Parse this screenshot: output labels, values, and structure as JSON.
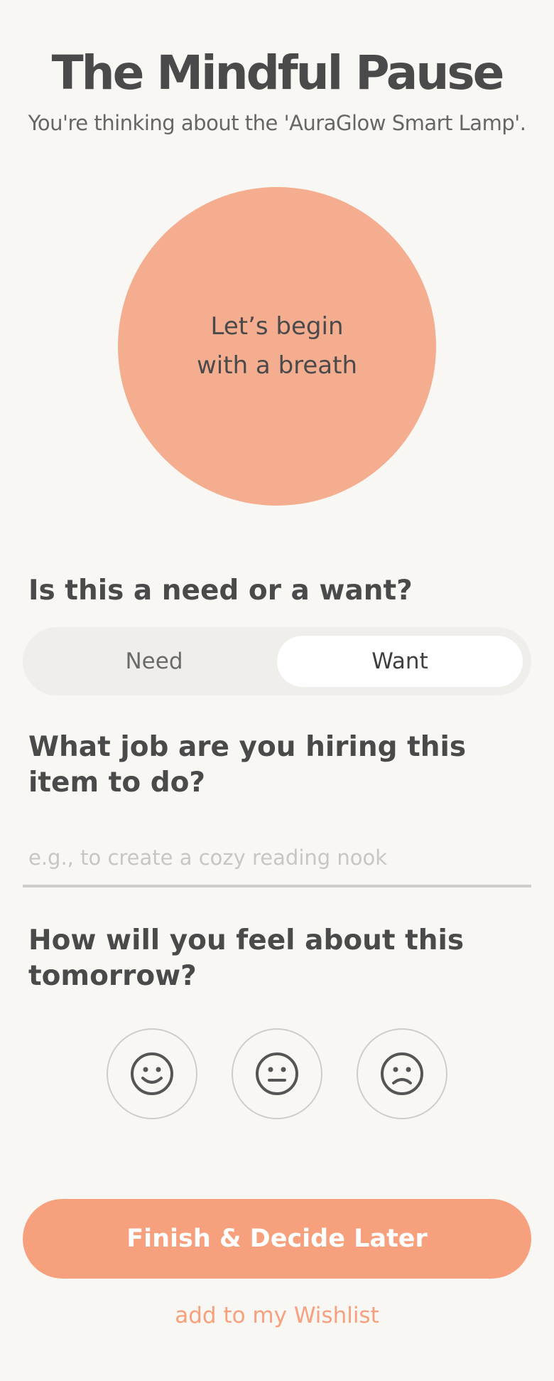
{
  "header": {
    "title": "The Mindful Pause",
    "subtitle": "You're thinking about the 'AuraGlow Smart Lamp'."
  },
  "breath": {
    "line1": "Let’s begin",
    "line2": "with a breath",
    "color": "#f5ad90"
  },
  "need_want": {
    "question": "Is this a need or a want?",
    "options": [
      "Need",
      "Want"
    ],
    "selected": "Want"
  },
  "job": {
    "question": "What job are you hiring this item to do?",
    "placeholder": "e.g., to create a cozy reading nook",
    "value": ""
  },
  "feeling": {
    "question": "How will you feel about this tomorrow?",
    "options": [
      {
        "icon": "happy-face-icon"
      },
      {
        "icon": "neutral-face-icon"
      },
      {
        "icon": "sad-face-icon"
      }
    ]
  },
  "actions": {
    "primary_label": "Finish & Decide Later",
    "secondary_label": "add to my Wishlist",
    "accent": "#f7a07e"
  }
}
